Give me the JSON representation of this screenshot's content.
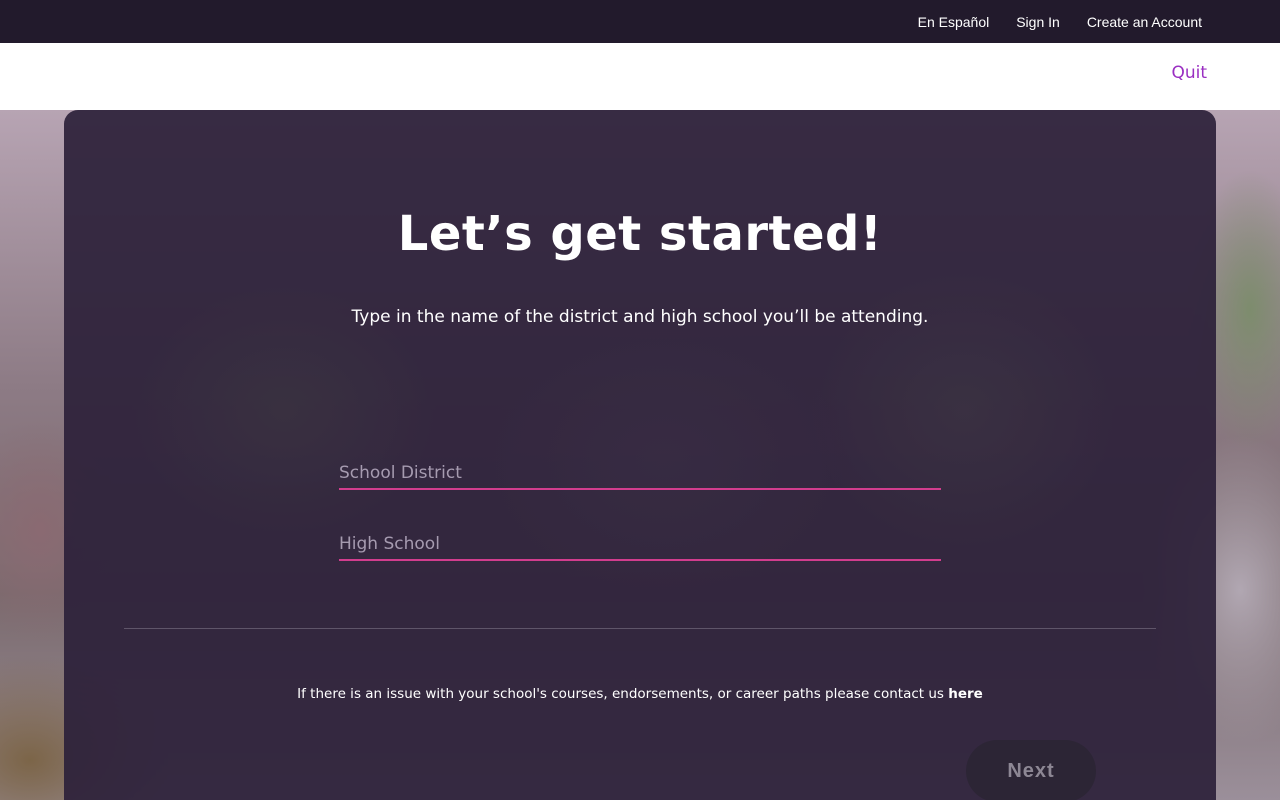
{
  "topbar": {
    "spanish_link": "En Español",
    "sign_in_link": "Sign In",
    "create_account_link": "Create an Account"
  },
  "header": {
    "quit_label": "Quit"
  },
  "main": {
    "title": "Let’s get started!",
    "subtitle": "Type in the name of the district and high school you’ll be attending.",
    "district_field": {
      "placeholder": "School District",
      "value": ""
    },
    "school_field": {
      "placeholder": "High School",
      "value": ""
    },
    "contact_text": "If there is an issue with your school's courses, endorsements, or career paths please contact us",
    "contact_link": "here",
    "next_label": "Next"
  },
  "colors": {
    "topbar": "#221a2c",
    "accent_purple": "#9a2fc2",
    "field_underline": "#d23d8e",
    "card_overlay": "#2d213a"
  }
}
